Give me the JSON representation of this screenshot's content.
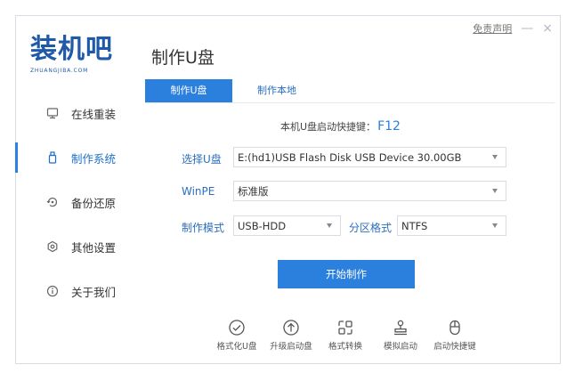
{
  "logo": {
    "main": "装机吧",
    "sub": "ZHUANGJIBA.COM"
  },
  "page_title": "制作U盘",
  "window_controls": {
    "disclaimer": "免责声明",
    "minimize": "—",
    "close": "×"
  },
  "sidebar": {
    "items": [
      {
        "label": "在线重装",
        "icon": "monitor-icon"
      },
      {
        "label": "制作系统",
        "icon": "usb-icon",
        "active": true
      },
      {
        "label": "备份还原",
        "icon": "backup-icon"
      },
      {
        "label": "其他设置",
        "icon": "gear-icon"
      },
      {
        "label": "关于我们",
        "icon": "info-icon"
      }
    ]
  },
  "tabs": [
    {
      "label": "制作U盘",
      "active": true
    },
    {
      "label": "制作本地"
    }
  ],
  "hint": {
    "text": "本机U盘启动快捷键：",
    "key": "F12"
  },
  "form": {
    "usb_label": "选择U盘",
    "usb_value": "E:(hd1)USB Flash Disk USB Device 30.00GB",
    "winpe_label": "WinPE",
    "winpe_value": "标准版",
    "mode_label": "制作模式",
    "mode_value": "USB-HDD",
    "partition_label": "分区格式",
    "partition_value": "NTFS"
  },
  "start_button": "开始制作",
  "tools": [
    {
      "label": "格式化U盘",
      "icon": "check-circle-icon"
    },
    {
      "label": "升级启动盘",
      "icon": "upload-circle-icon"
    },
    {
      "label": "格式转换",
      "icon": "convert-icon"
    },
    {
      "label": "模拟启动",
      "icon": "simulate-icon"
    },
    {
      "label": "启动快捷键",
      "icon": "mouse-icon"
    }
  ],
  "colors": {
    "accent": "#2b7fdd",
    "link": "#2b6fbf",
    "logo": "#1f5aa8"
  }
}
